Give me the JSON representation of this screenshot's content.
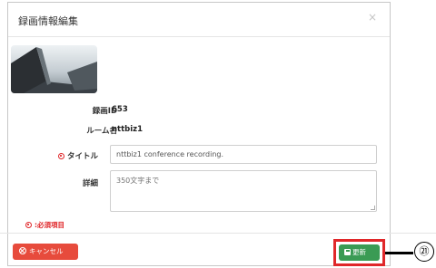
{
  "dialog": {
    "title": "録画情報編集",
    "close_glyph": "×"
  },
  "thumbnail": {
    "alt": "recording-thumbnail"
  },
  "fields": {
    "recording_id_label": "録画ID",
    "recording_id_value": "653",
    "room_name_label": "ルーム名",
    "room_name_value": "nttbiz1",
    "title_label": "タイトル",
    "title_value": "nttbiz1 conference recording.",
    "detail_label": "詳細",
    "detail_placeholder": "350文字まで"
  },
  "required_note": ":必須項目",
  "buttons": {
    "cancel_label": "キャンセル",
    "update_label": "更新"
  },
  "annotation": {
    "callout_number": "㉑",
    "color": "#e0272a"
  },
  "colors": {
    "cancel_button": "#e74b3c",
    "update_button": "#3a9b54",
    "required": "#e0272a"
  }
}
